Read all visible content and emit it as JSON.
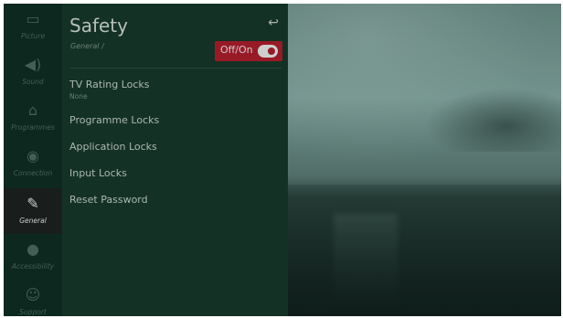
{
  "rail": {
    "items": [
      {
        "label": "Picture",
        "icon": "monitor-icon"
      },
      {
        "label": "Sound",
        "icon": "speaker-icon"
      },
      {
        "label": "Programmes",
        "icon": "antenna-icon"
      },
      {
        "label": "Connection",
        "icon": "globe-icon"
      },
      {
        "label": "General",
        "icon": "wrench-icon"
      },
      {
        "label": "Accessibility",
        "icon": "accessibility-icon"
      },
      {
        "label": "Support",
        "icon": "support-icon"
      }
    ],
    "active_index": 4
  },
  "header": {
    "title": "Safety",
    "breadcrumb": "General /",
    "back_icon": "back-arrow-icon"
  },
  "toggle": {
    "label": "Off/On",
    "state": "on"
  },
  "menu": {
    "items": [
      {
        "label": "TV Rating Locks",
        "value": "None"
      },
      {
        "label": "Programme Locks"
      },
      {
        "label": "Application Locks"
      },
      {
        "label": "Input Locks"
      },
      {
        "label": "Reset Password"
      }
    ]
  },
  "colors": {
    "accent_red": "#b21a2b",
    "panel_green": "#173528",
    "rail_green": "#0f2b22"
  }
}
